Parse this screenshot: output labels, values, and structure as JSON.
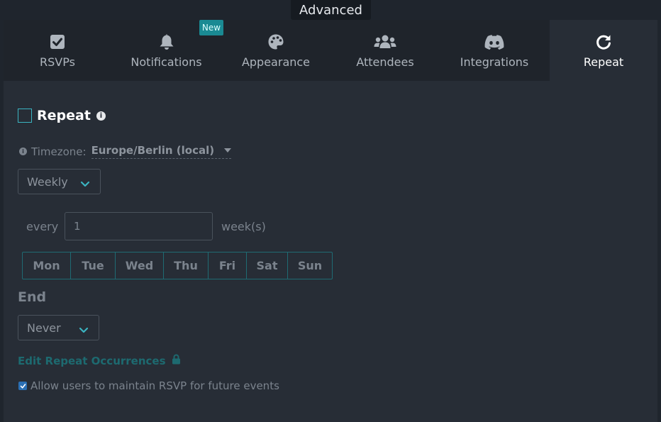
{
  "header": {
    "section_label": "Advanced"
  },
  "tabs": [
    {
      "label": "RSVPs",
      "icon": "checkbox-icon"
    },
    {
      "label": "Notifications",
      "icon": "bell-icon",
      "badge": "New"
    },
    {
      "label": "Appearance",
      "icon": "palette-icon"
    },
    {
      "label": "Attendees",
      "icon": "users-icon"
    },
    {
      "label": "Integrations",
      "icon": "discord-icon"
    },
    {
      "label": "Repeat",
      "icon": "refresh-icon",
      "active": true
    }
  ],
  "repeat": {
    "title": "Repeat",
    "checked": false,
    "info_glyph": "i",
    "timezone_label": "Timezone:",
    "timezone_value": "Europe/Berlin (local)",
    "frequency": "Weekly",
    "every_label": "every",
    "every_value": "1",
    "unit_label": "week(s)",
    "days": [
      "Mon",
      "Tue",
      "Wed",
      "Thu",
      "Fri",
      "Sat",
      "Sun"
    ],
    "end_label": "End",
    "end_value": "Never",
    "edit_occurrences_label": "Edit Repeat Occurrences",
    "allow_label": "Allow users to maintain RSVP for future events",
    "allow_checked": true
  },
  "colors": {
    "background": "#1f252d",
    "panel": "#272d36",
    "tabbar": "#1f242b",
    "accent": "#1a8a93",
    "link": "#1d6a70",
    "checkbox_blue": "#2b6fb3"
  }
}
